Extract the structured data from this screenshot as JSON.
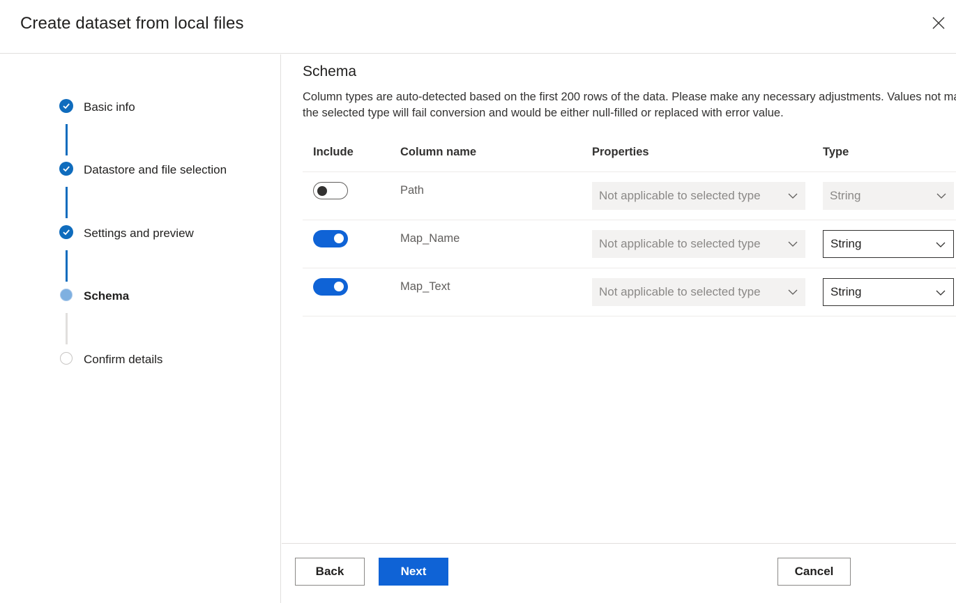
{
  "dialog": {
    "title": "Create dataset from local files",
    "close_icon": "close-icon"
  },
  "steps": [
    {
      "label": "Basic info",
      "state": "done"
    },
    {
      "label": "Datastore and file selection",
      "state": "done"
    },
    {
      "label": "Settings and preview",
      "state": "done"
    },
    {
      "label": "Schema",
      "state": "current"
    },
    {
      "label": "Confirm details",
      "state": "pending"
    }
  ],
  "schema": {
    "title": "Schema",
    "description": "Column types are auto-detected based on the first 200 rows of the data. Please make any necessary adjustments. Values not matching the selected type will fail conversion and would be either null-filled or replaced with error value.",
    "columns": {
      "include": "Include",
      "name": "Column name",
      "properties": "Properties",
      "type": "Type"
    },
    "rows": [
      {
        "include": false,
        "name": "Path",
        "properties": "Not applicable to selected type",
        "type": "String",
        "type_enabled": false
      },
      {
        "include": true,
        "name": "Map_Name",
        "properties": "Not applicable to selected type",
        "type": "String",
        "type_enabled": true
      },
      {
        "include": true,
        "name": "Map_Text",
        "properties": "Not applicable to selected type",
        "type": "String",
        "type_enabled": true
      }
    ]
  },
  "footer": {
    "back_label": "Back",
    "next_label": "Next",
    "cancel_label": "Cancel"
  },
  "colors": {
    "accent": "#0f6cbd",
    "primary_button": "#0f63d6",
    "toggle_on": "#0f63d6"
  }
}
